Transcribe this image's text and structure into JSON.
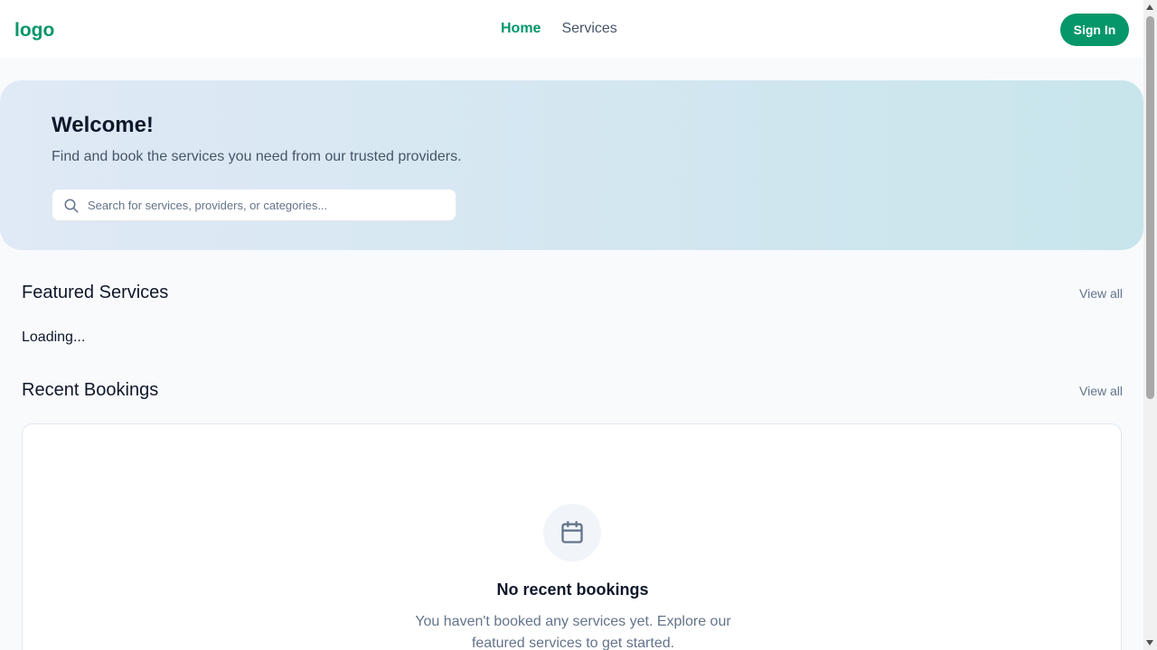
{
  "header": {
    "logo": "logo",
    "nav": [
      {
        "label": "Home",
        "active": true
      },
      {
        "label": "Services",
        "active": false
      }
    ],
    "sign_in_label": "Sign In"
  },
  "hero": {
    "title": "Welcome!",
    "subtitle": "Find and book the services you need from our trusted providers.",
    "search": {
      "icon": "search-icon",
      "placeholder": "Search for services, providers, or categories...",
      "value": ""
    }
  },
  "featured": {
    "title": "Featured Services",
    "view_all": "View all",
    "status": "Loading..."
  },
  "recent": {
    "title": "Recent Bookings",
    "view_all": "View all",
    "empty": {
      "icon": "calendar-icon",
      "title": "No recent bookings",
      "message": "You haven't booked any services yet. Explore our featured services to get started."
    }
  },
  "colors": {
    "accent": "#059669",
    "text_primary": "#0f172a",
    "text_muted": "#64748b"
  }
}
